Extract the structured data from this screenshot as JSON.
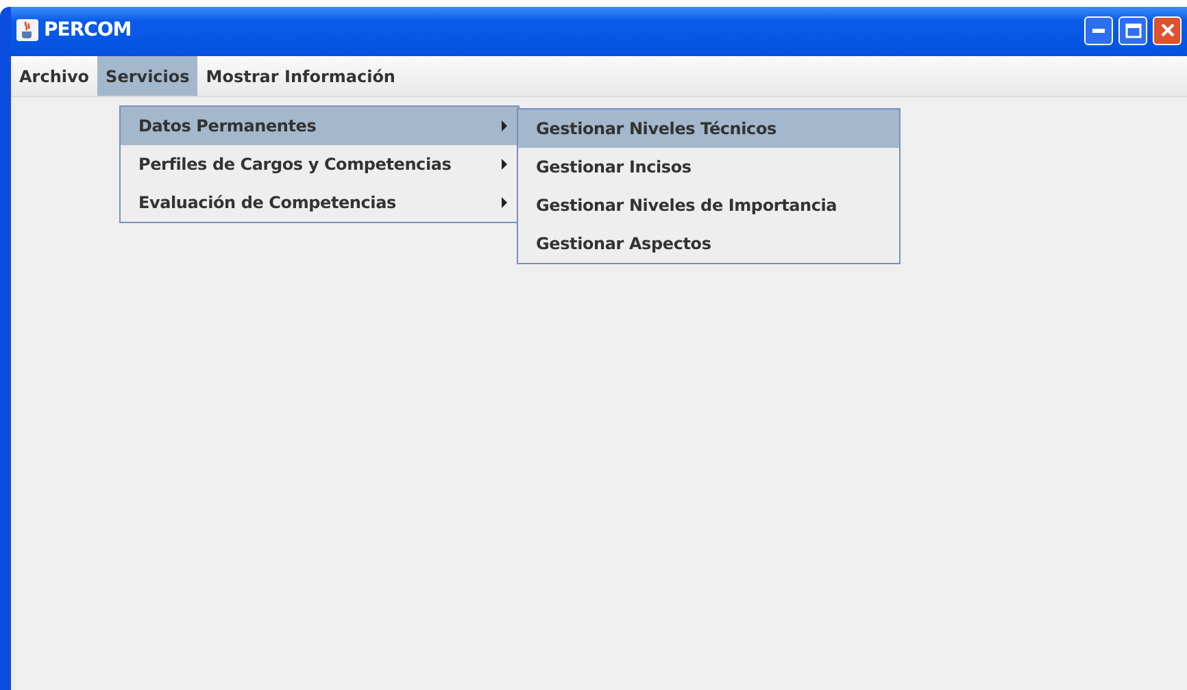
{
  "window": {
    "title": "PERCOM"
  },
  "menu_bar": [
    {
      "label": "Archivo",
      "selected": false
    },
    {
      "label": "Servicios",
      "selected": true
    },
    {
      "label": "Mostrar Información",
      "selected": false
    }
  ],
  "menu": [
    {
      "label": "Datos Permanentes",
      "selected": true,
      "has_submenu": true
    },
    {
      "label": "Perfiles de Cargos y Competencias",
      "selected": false,
      "has_submenu": true
    },
    {
      "label": "Evaluación de Competencias",
      "selected": false,
      "has_submenu": true
    }
  ],
  "submenu": [
    {
      "label": "Gestionar Niveles Técnicos",
      "selected": true
    },
    {
      "label": "Gestionar Incisos",
      "selected": false
    },
    {
      "label": "Gestionar Niveles de Importancia",
      "selected": false
    },
    {
      "label": "Gestionar Aspectos",
      "selected": false
    }
  ]
}
